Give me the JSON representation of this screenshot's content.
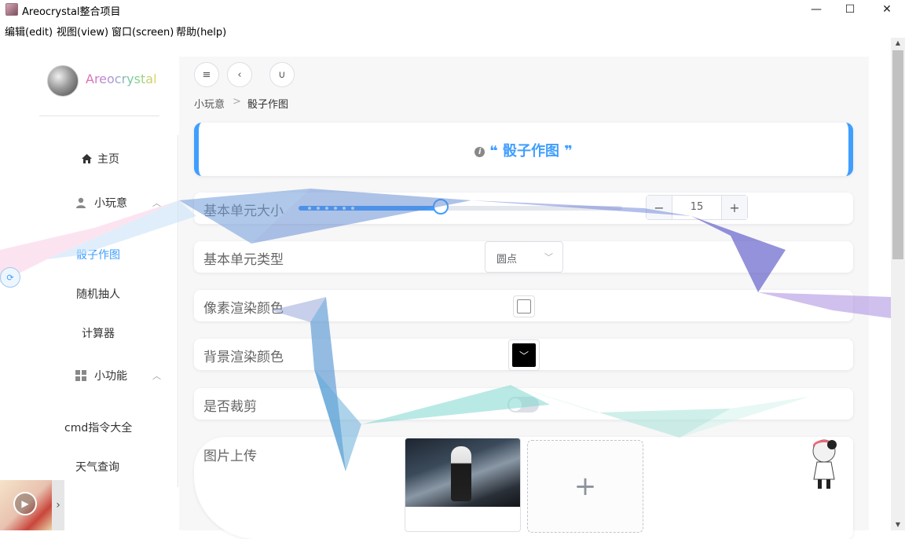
{
  "window": {
    "title": "Areocrystal整合项目",
    "minimize": "—",
    "maximize": "☐",
    "close": "✕"
  },
  "menu": [
    {
      "label": "编辑(edit)"
    },
    {
      "label": "视图(view)"
    },
    {
      "label": "窗口(screen)"
    },
    {
      "label": "帮助(help)"
    }
  ],
  "sidebar": {
    "brand": "Areocrystal",
    "items": {
      "home": "主页",
      "toys": "小玩意",
      "dice": "骰子作图",
      "random": "随机抽人",
      "calculator": "计算器",
      "features": "小功能",
      "cmd": "cmd指令大全",
      "weather": "天气查询"
    }
  },
  "breadcrumb": {
    "parent": "小玩意",
    "separator": ">",
    "current": "骰子作图"
  },
  "header": {
    "title": "骰子作图"
  },
  "form": {
    "unit_size": {
      "label": "基本单元大小",
      "value": "15",
      "fraction": 0.44
    },
    "unit_type": {
      "label": "基本单元类型",
      "value": "圆点"
    },
    "pixel_color": {
      "label": "像素渲染颜色",
      "value": "#ffffff"
    },
    "bg_color": {
      "label": "背景渲染颜色",
      "value": "#000000"
    },
    "crop": {
      "label": "是否裁剪",
      "on": false
    },
    "upload": {
      "label": "图片上传",
      "add_symbol": "+"
    }
  },
  "colors": {
    "accent": "#409eff"
  },
  "icons": {
    "menu": "hamburger-icon",
    "back": "chevron-left-icon",
    "magnet": "magnet-icon",
    "home": "home-icon",
    "user": "user-icon",
    "grid": "grid-icon",
    "info": "info-icon"
  }
}
